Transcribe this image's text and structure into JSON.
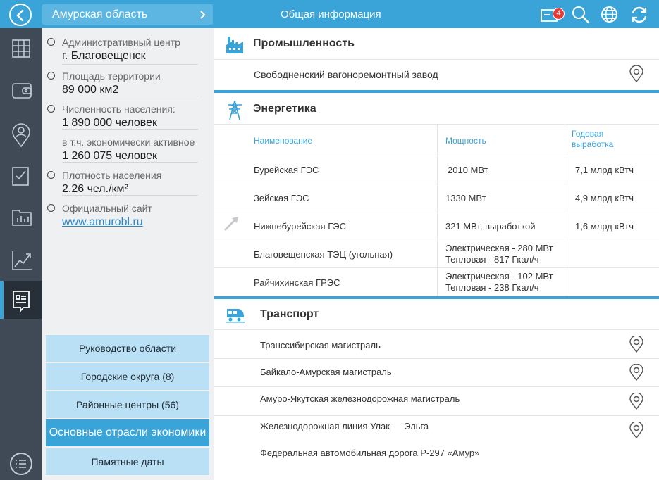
{
  "header": {
    "region": "Амурская область",
    "title": "Общая информация",
    "notifications_count": "4"
  },
  "info": [
    {
      "label": "Административный центр",
      "value": "г. Благовещенск"
    },
    {
      "label": "Площадь территории",
      "value": "89 000 км2"
    },
    {
      "label": "Численность населения:",
      "value": "1 890 000 человек"
    },
    {
      "label": "в т.ч. экономически активное",
      "value": "1 260 075 человек"
    },
    {
      "label": "Плотность населения",
      "value": "2.26 чел./км²"
    },
    {
      "label": "Официальный сайт",
      "value": "www.amurobl.ru"
    }
  ],
  "left_buttons": [
    "Руководство области",
    "Городские округа (8)",
    "Районные центры (56)",
    "Основные отрасли экономики",
    "Памятные даты"
  ],
  "industry": {
    "title": "Промышленность",
    "items": [
      "Свободненский вагоноремонтный завод"
    ]
  },
  "energy": {
    "title": "Энергетика",
    "headers": {
      "name": "Наименование",
      "power": "Мощность",
      "output_1": "Годовая",
      "output_2": "выработка"
    },
    "rows": [
      {
        "name": "Бурейская ГЭС",
        "power_1": "2010 МВт",
        "power_2": "",
        "output": "7,1 млрд кВтч"
      },
      {
        "name": "Зейская ГЭС",
        "power_1": "1330 МВт",
        "power_2": "",
        "output": "4,9 млрд кВтч"
      },
      {
        "name": "Нижнебурейская ГЭС",
        "power_1": "321 МВт, выработкой",
        "power_2": "",
        "output": "1,6 млрд кВтч"
      },
      {
        "name": "Благовещенская ТЭЦ (угольная)",
        "power_1": "Электрическая  - 280 МВт",
        "power_2": "Тепловая - 817 Гкал/ч",
        "output": ""
      },
      {
        "name": "Райчихинская ГРЭС",
        "power_1": "Электрическая  - 102 МВт",
        "power_2": "Тепловая - 238 Гкал/ч",
        "output": ""
      }
    ]
  },
  "transport": {
    "title": "Транспорт",
    "items": [
      "Транссибирская магистраль",
      "Байкало-Амурская магистраль",
      "Амуро-Якутская железнодорожная магистраль",
      "Железнодорожная линия Улак — Эльга",
      "Федеральная автомобильная дорога Р-297 «Амур»"
    ]
  },
  "icons": {
    "top": [
      "back-icon",
      "chevron-right-icon",
      "messages-icon",
      "search-icon",
      "globe-icon",
      "refresh-icon"
    ],
    "rail": [
      "grid-icon",
      "wallet-icon",
      "person-pin-icon",
      "checklist-icon",
      "folder-chart-icon",
      "trend-icon",
      "document-icon",
      "menu-icon"
    ]
  },
  "colors": {
    "accent": "#3aa3d8",
    "rail": "#3f4a56",
    "panel": "#eff0f2",
    "button": "#b9e0f4"
  }
}
